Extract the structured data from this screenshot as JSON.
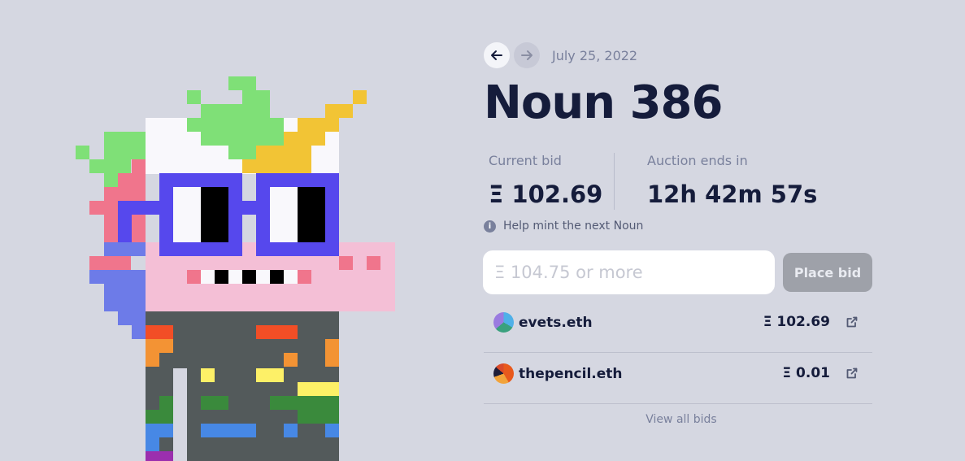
{
  "auction": {
    "date": "July 25, 2022",
    "title": "Noun 386",
    "current_bid_label": "Current bid",
    "current_bid_value": "Ξ 102.69",
    "ends_label": "Auction ends in",
    "ends_value": "12h 42m 57s",
    "help_text": "Help mint the next Noun",
    "bid_placeholder": "Ξ 104.75 or more",
    "place_bid_label": "Place bid",
    "view_all_label": "View all bids"
  },
  "bids": [
    {
      "bidder": "evets.eth",
      "amount": "Ξ 102.69"
    },
    {
      "bidder": "thepencil.eth",
      "amount": "Ξ 0.01"
    }
  ],
  "icons": {
    "prev": "arrow-left-icon",
    "next": "arrow-right-icon",
    "help": "info-icon",
    "external": "external-link-icon"
  },
  "colors": {
    "background": "#d5d7e1",
    "title": "#151c3b",
    "muted": "#79809c",
    "button_disabled": "#9ea1a9"
  }
}
